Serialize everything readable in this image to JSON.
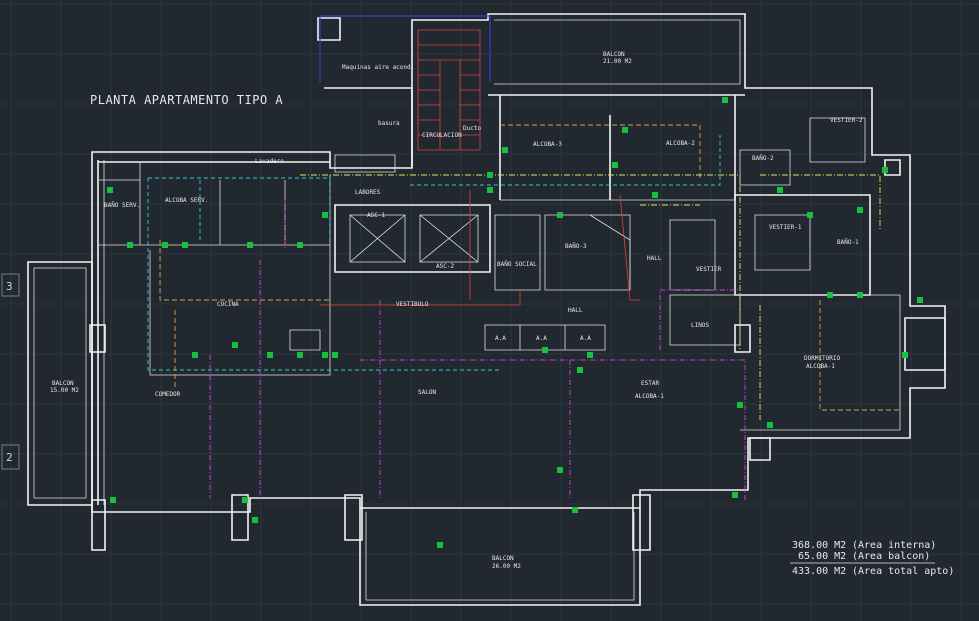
{
  "drawing": {
    "title": "PLANTA APARTAMENTO TIPO A",
    "axis_labels": [
      "3",
      "2"
    ],
    "rooms": [
      {
        "id": "balcon-top",
        "label": "BALCON",
        "area": "21.00 M2"
      },
      {
        "id": "maquinas",
        "label": "Maquinas aire acond."
      },
      {
        "id": "circulacion",
        "label": "CIRCULACION"
      },
      {
        "id": "basura",
        "label": "basura"
      },
      {
        "id": "ducto",
        "label": "Ducto"
      },
      {
        "id": "lavadero",
        "label": "Lavadero"
      },
      {
        "id": "labores",
        "label": "LABORES"
      },
      {
        "id": "bano-serv",
        "label": "BAÑO SERV."
      },
      {
        "id": "alcoba-serv",
        "label": "ALCOBA SERV."
      },
      {
        "id": "alcoba-3",
        "label": "ALCOBA-3"
      },
      {
        "id": "alcoba-2",
        "label": "ALCOBA-2"
      },
      {
        "id": "bano-2",
        "label": "BAÑO-2"
      },
      {
        "id": "vestier-2",
        "label": "VESTIER-2"
      },
      {
        "id": "asc-1",
        "label": "ASC-1"
      },
      {
        "id": "asc-2",
        "label": "ASC-2"
      },
      {
        "id": "bano-3",
        "label": "BAÑO-3"
      },
      {
        "id": "bano-social",
        "label": "BAÑO SOCIAL"
      },
      {
        "id": "hall-right",
        "label": "HALL"
      },
      {
        "id": "vestier",
        "label": "VESTIER"
      },
      {
        "id": "vestier-1",
        "label": "VESTIER-1"
      },
      {
        "id": "bano-1",
        "label": "BAÑO-1"
      },
      {
        "id": "cocina",
        "label": "COCINA"
      },
      {
        "id": "vestibulo",
        "label": "VESTIBULO"
      },
      {
        "id": "hall",
        "label": "HALL"
      },
      {
        "id": "linos",
        "label": "LINOS"
      },
      {
        "id": "dormitorio",
        "label": "DORMITORIO",
        "sub": "ALCOBA-1"
      },
      {
        "id": "balcon-left",
        "label": "BALCON",
        "area": "15.00 M2"
      },
      {
        "id": "comedor",
        "label": "COMEDOR"
      },
      {
        "id": "salon",
        "label": "SALON"
      },
      {
        "id": "estar",
        "label": "ESTAR",
        "sub": "ALCOBA-1"
      },
      {
        "id": "balcon-bottom",
        "label": "BALCON",
        "area": "26.00 M2"
      },
      {
        "id": "aa-1",
        "label": "A.A"
      },
      {
        "id": "aa-2",
        "label": "A.A"
      },
      {
        "id": "aa-3",
        "label": "A.A"
      }
    ],
    "areas": [
      {
        "value": "368.00 M2",
        "desc": "(Area interna)"
      },
      {
        "value": "65.00 M2",
        "desc": "(Area balcon)"
      },
      {
        "value": "433.00 M2",
        "desc": "(Area total apto)"
      }
    ],
    "colors": {
      "background": "#212830",
      "walls": "#f2f2f2",
      "electrical_red": "#e04040",
      "circuit_magenta": "#d040d0",
      "circuit_cyan": "#30c8d8",
      "circuit_orange": "#e0a040",
      "circuit_yellow": "#e8e060",
      "outlets_green": "#18c040"
    }
  }
}
